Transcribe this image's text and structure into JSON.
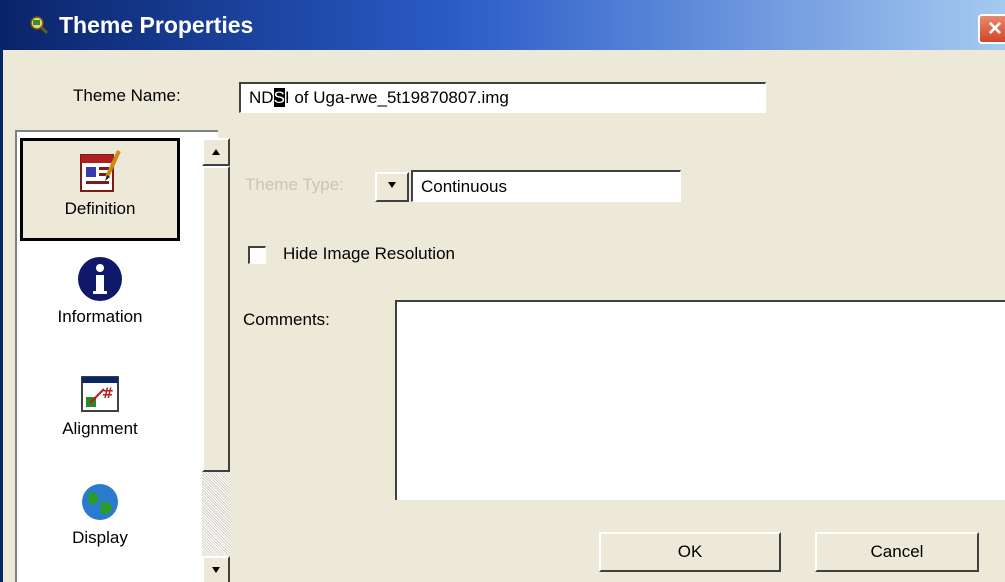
{
  "window": {
    "title": "Theme Properties",
    "close_glyph": "×"
  },
  "theme_name": {
    "label": "Theme Name:",
    "value_before": "ND",
    "value_selected": "S",
    "value_after": "I of Uga-rwe_5t19870807.img"
  },
  "sidebar": {
    "items": [
      {
        "label": "Definition",
        "icon": "definition-icon",
        "active": true
      },
      {
        "label": "Information",
        "icon": "information-icon",
        "active": false
      },
      {
        "label": "Alignment",
        "icon": "alignment-icon",
        "active": false
      },
      {
        "label": "Display",
        "icon": "globe-icon",
        "active": false
      }
    ]
  },
  "definition": {
    "theme_type_label": "Theme Type:",
    "theme_type_value": "Continuous",
    "hide_resolution_label": "Hide Image Resolution",
    "hide_resolution_checked": false,
    "comments_label": "Comments:",
    "comments_value": ""
  },
  "buttons": {
    "ok": "OK",
    "cancel": "Cancel"
  },
  "colors": {
    "title_start": "#0a246a",
    "title_end": "#a6caf0",
    "dialog_bg": "#ece9d8",
    "close_red": "#d2432b"
  }
}
